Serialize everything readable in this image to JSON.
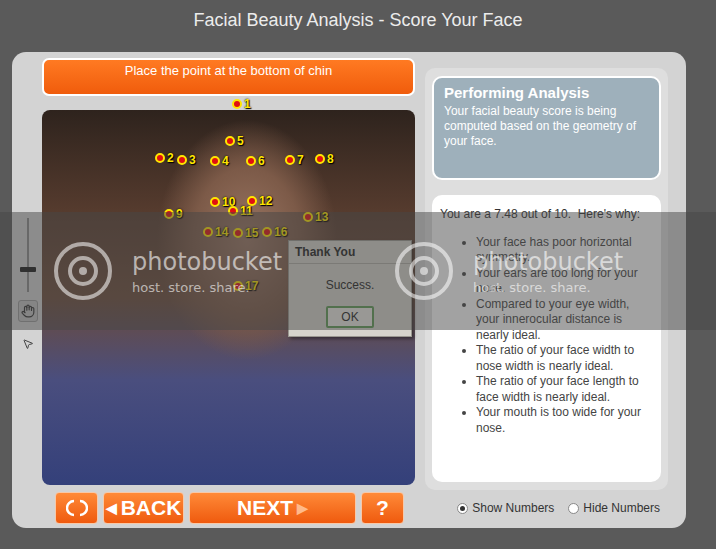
{
  "window": {
    "title": "Facial Beauty Analysis - Score Your Face"
  },
  "instruction": "Place the point at the bottom of chin",
  "zoom_slider": {
    "level": 0.3
  },
  "points": [
    {
      "label": "1"
    },
    {
      "label": "2"
    },
    {
      "label": "3"
    },
    {
      "label": "4"
    },
    {
      "label": "5"
    },
    {
      "label": "6"
    },
    {
      "label": "7"
    },
    {
      "label": "8"
    },
    {
      "label": "9"
    },
    {
      "label": "10"
    },
    {
      "label": "11"
    },
    {
      "label": "12"
    },
    {
      "label": "13"
    },
    {
      "label": "14"
    },
    {
      "label": "15"
    },
    {
      "label": "16"
    },
    {
      "label": "17"
    }
  ],
  "dialog": {
    "title": "Thank You",
    "message": "Success.",
    "button": "OK"
  },
  "analysis": {
    "title": "Performing Analysis",
    "text": "Your facial beauty score is being computed based on the geometry of your face."
  },
  "results": {
    "summary": "You are a 7.48 out of 10.  Here's why:",
    "reasons": [
      "Your face has poor horizontal symmetry.",
      "Your ears are too long for your nose.",
      "Compared to your eye width, your innerocular distance is nearly ideal.",
      "The ratio of your face width to nose width is nearly ideal.",
      "The ratio of your face length to face width is nearly ideal.",
      "Your mouth is too wide for your nose."
    ]
  },
  "buttons": {
    "back": {
      "arrow": "◀",
      "label": "BACK"
    },
    "next": {
      "label": "NEXT",
      "arrow": "▶"
    },
    "help": "?"
  },
  "number_display": [
    {
      "label": "Show Numbers",
      "selected": true
    },
    {
      "label": "Hide Numbers",
      "selected": false
    }
  ],
  "watermarks": [
    {
      "brand": "photobucket",
      "tagline": "host. store. share."
    },
    {
      "brand": "photobucket",
      "tagline": "host. store. share."
    }
  ]
}
